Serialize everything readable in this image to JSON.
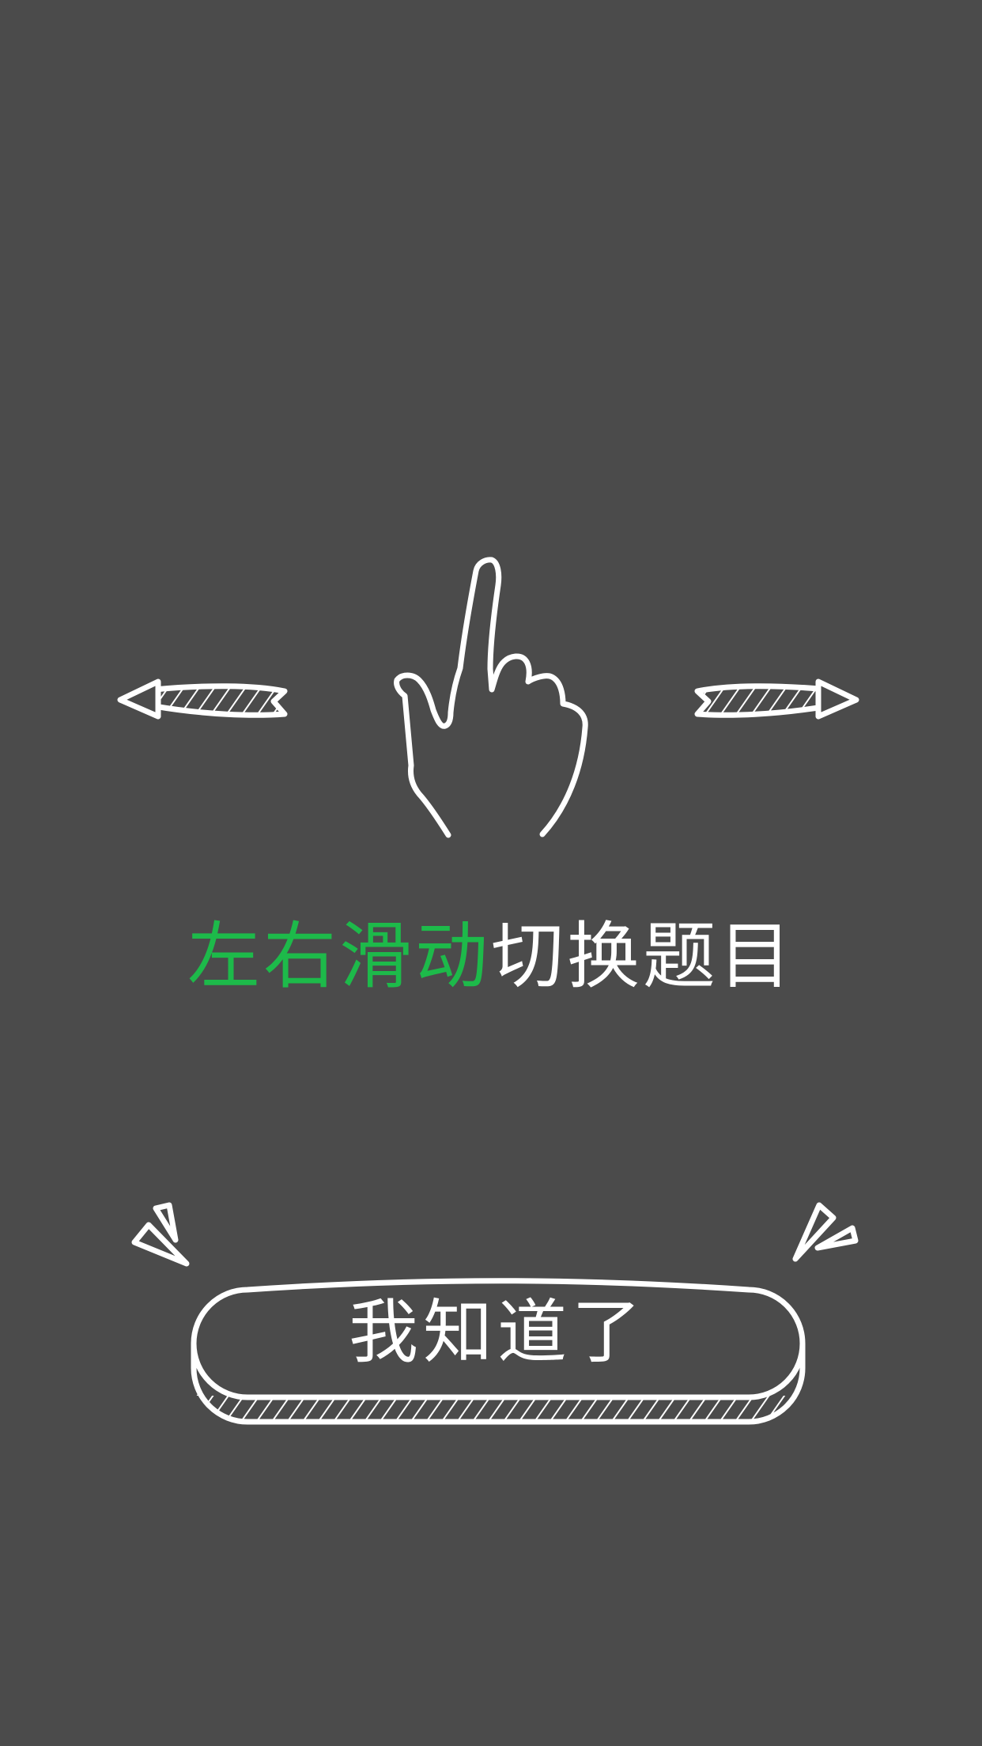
{
  "guide": {
    "hint_highlight": "左右滑动",
    "hint_rest": "切换题目",
    "confirm_label": "我知道了"
  },
  "colors": {
    "background": "#4b4b4b",
    "highlight": "#1dba4a",
    "line": "#ffffff"
  },
  "icons": [
    "left-arrow-icon",
    "right-arrow-icon",
    "swipe-hand-icon",
    "sparkle-icon"
  ]
}
